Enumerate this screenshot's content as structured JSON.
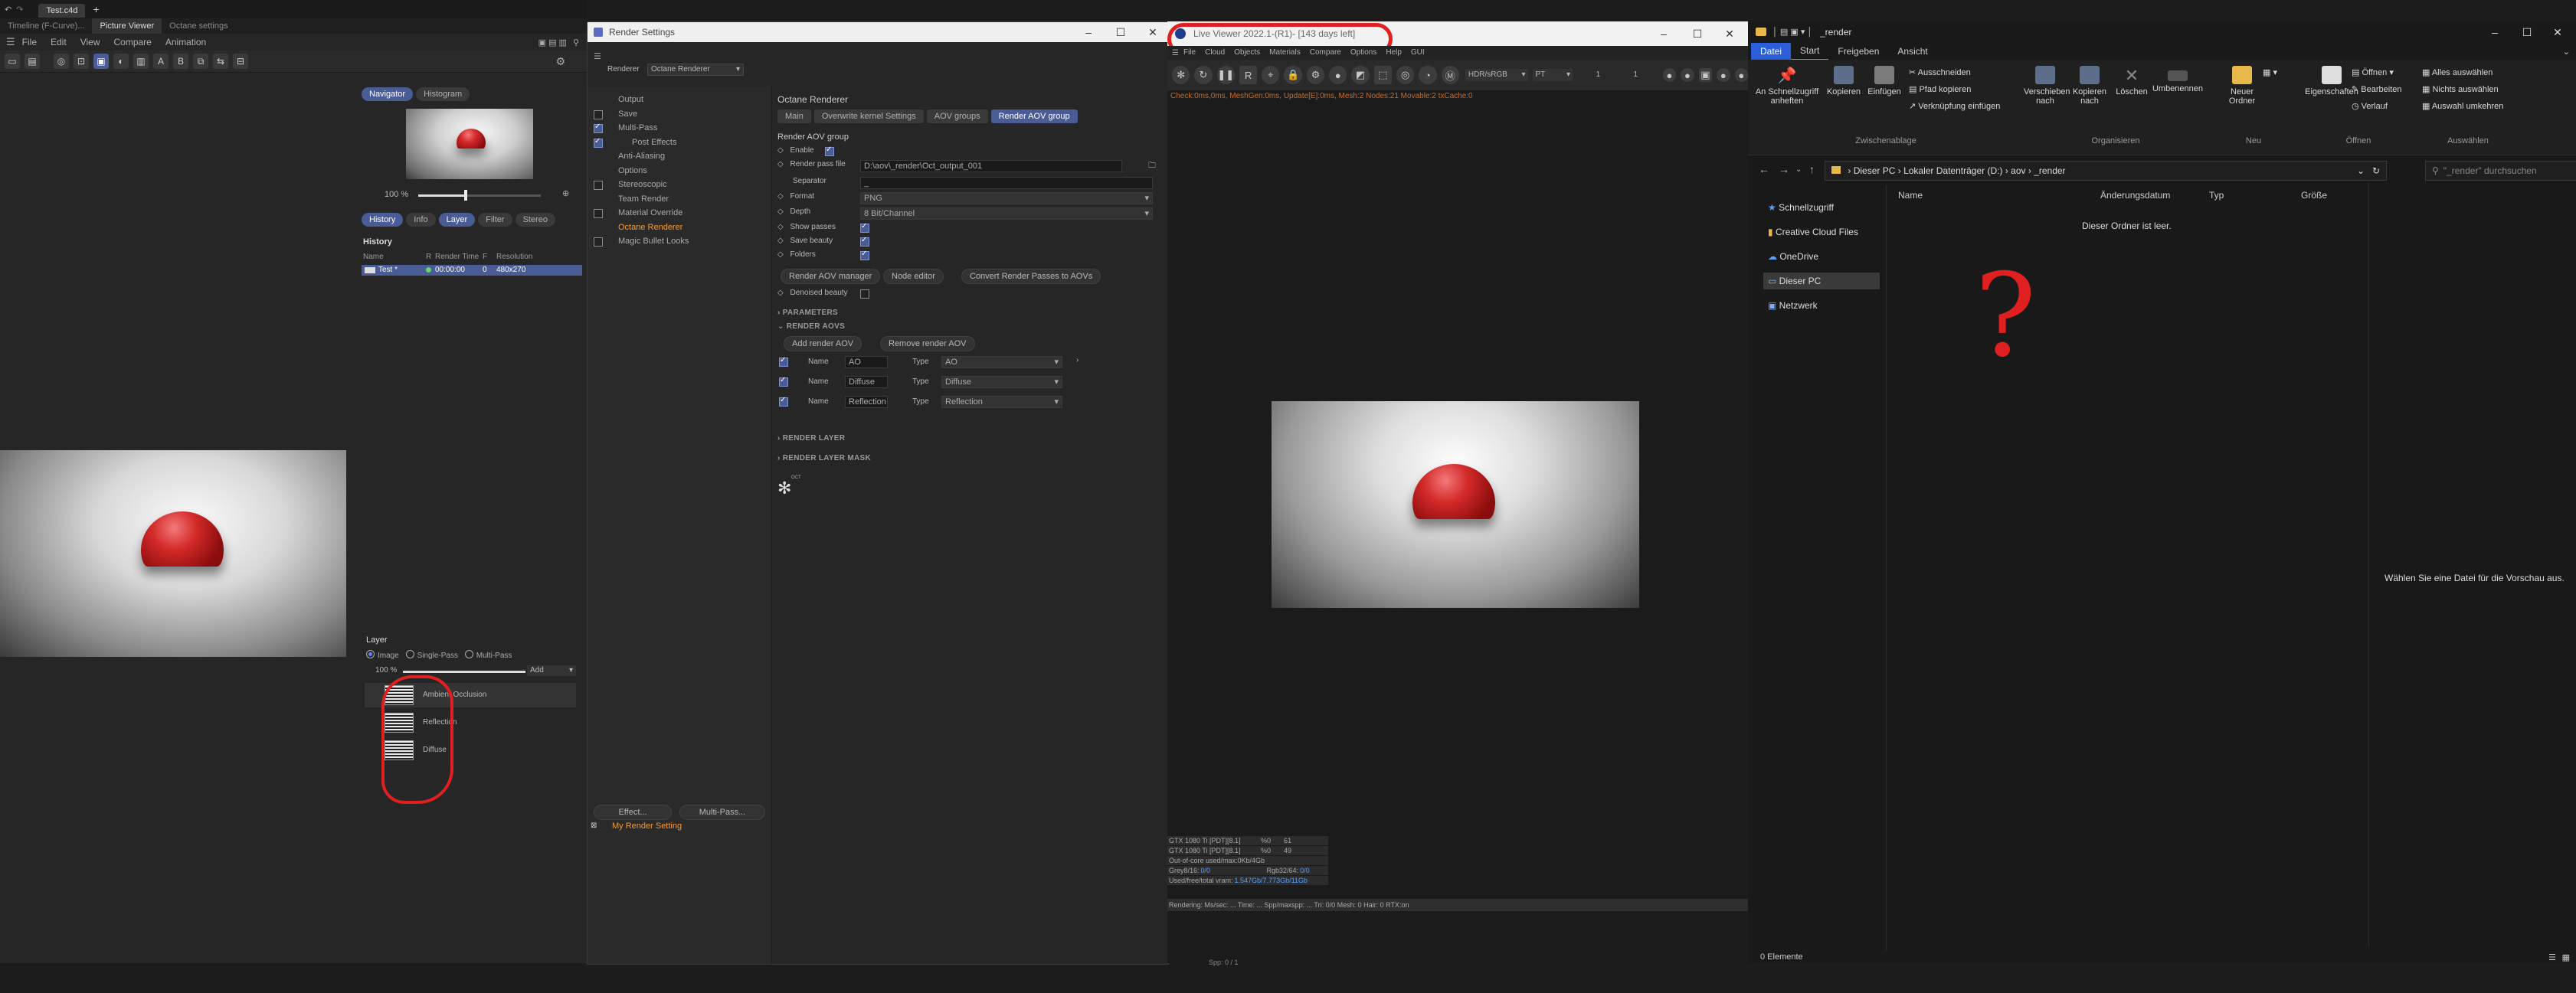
{
  "c4d": {
    "file_tab": "Test.c4d",
    "new_tab": "+",
    "tabs": [
      "Timeline (F-Curve)...",
      "Picture Viewer",
      "Octane settings"
    ],
    "menu": [
      "File",
      "Edit",
      "View",
      "Compare",
      "Animation"
    ],
    "nav_tabs": [
      "Navigator",
      "Histogram"
    ],
    "zoom": "100 %",
    "panel_tabs": [
      "History",
      "Info",
      "Layer",
      "Filter",
      "Stereo"
    ],
    "history": {
      "title": "History",
      "columns": [
        "Name",
        "R",
        "Render Time",
        "F",
        "Resolution"
      ],
      "row": {
        "name": "Test *",
        "time": "00:00:00",
        "f": "0",
        "res": "480x270"
      }
    },
    "layer": {
      "title": "Layer",
      "modes": [
        "Image",
        "Single-Pass",
        "Multi-Pass"
      ],
      "zoom": "100 %",
      "add": "Add",
      "items": [
        "Ambient Occlusion",
        "Reflection",
        "Diffuse"
      ]
    }
  },
  "render_settings": {
    "title": "Render Settings",
    "renderer_label": "Renderer",
    "renderer_value": "Octane Renderer",
    "tree": [
      {
        "label": "Output",
        "cb": false,
        "show_cb": false
      },
      {
        "label": "Save",
        "cb": false,
        "show_cb": true
      },
      {
        "label": "Multi-Pass",
        "cb": true,
        "show_cb": true
      },
      {
        "label": "Post Effects",
        "cb": true,
        "show_cb": true
      },
      {
        "label": "Anti-Aliasing",
        "cb": false,
        "show_cb": false
      },
      {
        "label": "Options",
        "cb": false,
        "show_cb": false
      },
      {
        "label": "Stereoscopic",
        "cb": false,
        "show_cb": true
      },
      {
        "label": "Team Render",
        "cb": false,
        "show_cb": false
      },
      {
        "label": "Material Override",
        "cb": false,
        "show_cb": true
      },
      {
        "label": "Octane Renderer",
        "cb": false,
        "show_cb": false
      },
      {
        "label": "Magic Bullet Looks",
        "cb": false,
        "show_cb": true
      }
    ],
    "effect_btn": "Effect...",
    "multipass_btn": "Multi-Pass...",
    "my_setting": "My Render Setting",
    "main": {
      "heading": "Octane Renderer",
      "tabs": [
        "Main",
        "Overwrite kernel Settings",
        "AOV groups",
        "Render AOV group"
      ],
      "group_title": "Render AOV group",
      "enable": "Enable",
      "render_pass_file_label": "Render pass file",
      "render_pass_file": "D:\\aov\\_render\\Oct_output_001",
      "separator_label": "Separator",
      "separator": "_",
      "format_label": "Format",
      "format": "PNG",
      "depth_label": "Depth",
      "depth": "8 Bit/Channel",
      "show_passes": "Show passes",
      "save_beauty": "Save beauty",
      "folders": "Folders",
      "btn_manager": "Render AOV manager",
      "btn_node": "Node editor",
      "btn_convert": "Convert Render Passes to AOVs",
      "denoised": "Denoised beauty",
      "parameters": "PARAMETERS",
      "render_aovs": "RENDER AOVS",
      "btn_add": "Add render AOV",
      "btn_remove": "Remove render AOV",
      "aov_name_label": "Name",
      "aov_type_label": "Type",
      "aovs": [
        {
          "name": "AO",
          "type": "AO"
        },
        {
          "name": "Diffuse",
          "type": "Diffuse"
        },
        {
          "name": "Reflection",
          "type": "Reflection"
        }
      ],
      "render_layer": "RENDER LAYER",
      "render_layer_mask": "RENDER LAYER MASK",
      "logo_text": "OCT"
    }
  },
  "live_viewer": {
    "title": "Live Viewer 2022.1-(R1)- [143 days left]",
    "menu": [
      "File",
      "Cloud",
      "Objects",
      "Materials",
      "Compare",
      "Options",
      "Help",
      "GUI"
    ],
    "color_space": "HDR/sRGB",
    "kernel": "PT",
    "val1": "1",
    "val2": "1",
    "status_line": "Check:0ms,0ms, MeshGen:0ms, Update[E]:0ms, Mesh:2 Nodes:21 Movable:2 txCache:0",
    "gpu": [
      {
        "name": "GTX 1080 Ti [PDT][8.1]",
        "pct": "%0",
        "val": "61"
      },
      {
        "name": "GTX 1080 Ti [PDT][8.1]",
        "pct": "%0",
        "val": "49"
      }
    ],
    "ooc": "Out-of-core used/max:0Kb/4Gb",
    "grey": "Grey8/16:",
    "grey_val": "0/0",
    "rgb": "Rgb32/64:",
    "rgb_val": "0/0",
    "vram": "Used/free/total vram:",
    "vram_val": "1.547Gb/7.773Gb/11Gb",
    "rendering": "Rendering:    Ms/sec: ...   Time: ...   Spp/maxspp: ...   Tri: 0/0   Mesh: 0   Hair: 0   RTX:on",
    "footer": "Spp: 0 / 1"
  },
  "explorer": {
    "title": "_render",
    "tabs": [
      "Datei",
      "Start",
      "Freigeben",
      "Ansicht"
    ],
    "ribbon": {
      "pin": "An Schnellzugriff anheften",
      "copy": "Kopieren",
      "paste": "Einfügen",
      "cut": "Ausschneiden",
      "copy_path": "Pfad kopieren",
      "paste_shortcut": "Verknüpfung einfügen",
      "clipboard": "Zwischenablage",
      "move_to": "Verschieben nach",
      "copy_to": "Kopieren nach",
      "delete": "Löschen",
      "rename": "Umbenennen",
      "organize": "Organisieren",
      "new_folder": "Neuer Ordner",
      "new": "Neu",
      "properties": "Eigenschaften",
      "open": "Öffnen",
      "edit": "Bearbeiten",
      "history": "Verlauf",
      "open_group": "Öffnen",
      "select_all": "Alles auswählen",
      "select_none": "Nichts auswählen",
      "invert": "Auswahl umkehren",
      "select_group": "Auswählen"
    },
    "breadcrumb": [
      "Dieser PC",
      "Lokaler Datenträger (D:)",
      "aov",
      "_render"
    ],
    "search_placeholder": "\"_render\" durchsuchen",
    "nav": [
      "Schnellzugriff",
      "Creative Cloud Files",
      "OneDrive",
      "Dieser PC",
      "Netzwerk"
    ],
    "columns": [
      "Name",
      "Änderungsdatum",
      "Typ",
      "Größe"
    ],
    "empty": "Dieser Ordner ist leer.",
    "preview": "Wählen Sie eine Datei für die Vorschau aus.",
    "status": "0 Elemente"
  },
  "annotations": {
    "question": "?"
  },
  "colors": {
    "accent_blue": "#4a5c96",
    "selection_orange": "#f29b3a",
    "annotation_red": "#e02020",
    "explorer_blue": "#2b5fd9"
  }
}
